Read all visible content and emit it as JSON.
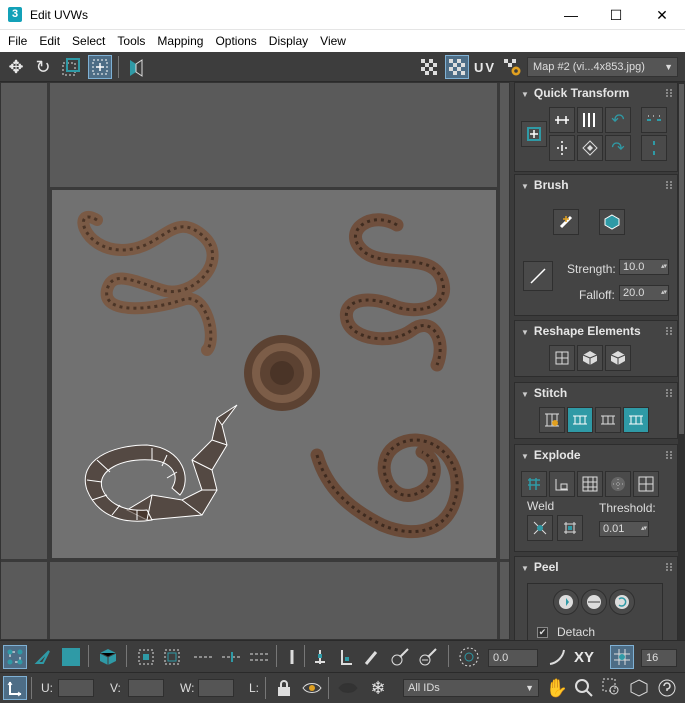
{
  "window": {
    "app_icon": "3",
    "title": "Edit UVWs",
    "minimize_glyph": "—",
    "maximize_glyph": "☐",
    "close_glyph": "✕"
  },
  "menu": [
    "File",
    "Edit",
    "Select",
    "Tools",
    "Mapping",
    "Options",
    "Display",
    "View"
  ],
  "toolbar": {
    "uv_label": "UV",
    "map_selector": "Map #2 (vi...4x853.jpg)"
  },
  "panel": {
    "quick_transform": {
      "title": "Quick Transform"
    },
    "brush": {
      "title": "Brush",
      "strength_label": "Strength:",
      "strength_value": "10.0",
      "falloff_label": "Falloff:",
      "falloff_value": "20.0"
    },
    "reshape": {
      "title": "Reshape Elements"
    },
    "stitch": {
      "title": "Stitch"
    },
    "explode": {
      "title": "Explode",
      "weld_label": "Weld",
      "threshold_label": "Threshold:",
      "threshold_value": "0.01"
    },
    "peel": {
      "title": "Peel",
      "detach_label": "Detach",
      "detach_checked": true
    }
  },
  "bottom": {
    "rotate_value": "0.0",
    "xy_label": "XY",
    "grid_value": "16",
    "u_label": "U:",
    "v_label": "V:",
    "w_label": "W:",
    "l_label": "L:",
    "ids_select": "All IDs"
  },
  "colors": {
    "accent": "#2f9aa6",
    "active_tool": "#4d6d86",
    "viewport_bg": "#5a5a5a",
    "texture_bg": "#717171"
  }
}
